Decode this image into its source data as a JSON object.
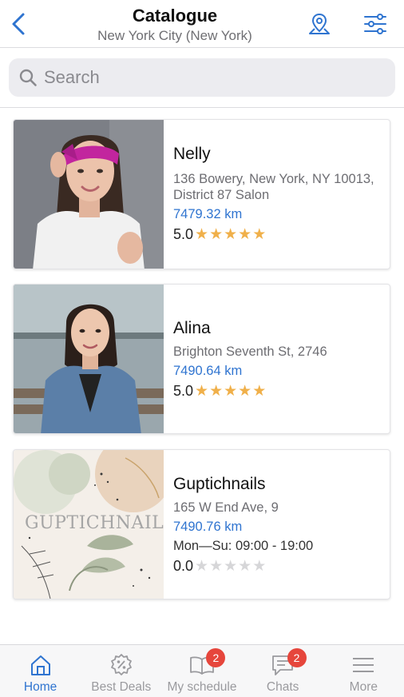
{
  "header": {
    "title": "Catalogue",
    "subtitle": "New York City (New York)",
    "back_icon": "chevron-left-icon",
    "map_icon": "map-pin-icon",
    "filter_icon": "sliders-icon"
  },
  "search": {
    "placeholder": "Search",
    "value": ""
  },
  "colors": {
    "accent": "#2f74d0",
    "star": "#f0b04a",
    "badge": "#e6463c"
  },
  "listings": [
    {
      "name": "Nelly",
      "address": "136 Bowery, New York, NY 10013, District 87 Salon",
      "distance": "7479.32 km",
      "rating": "5.0",
      "stars": 5
    },
    {
      "name": "Alina",
      "address": "Brighton Seventh St,  2746",
      "distance": "7490.64 km",
      "rating": "5.0",
      "stars": 5
    },
    {
      "name": "Guptichnails",
      "address": "165 W End Ave,  9",
      "distance": "7490.76 km",
      "hours": "Mon—Su: 09:00 - 19:00",
      "rating": "0.0",
      "stars": 0,
      "logo_text": "GUPTICHNAILS"
    }
  ],
  "tabs": [
    {
      "label": "Home",
      "icon": "home-icon",
      "active": true
    },
    {
      "label": "Best Deals",
      "icon": "discount-badge-icon"
    },
    {
      "label": "My schedule",
      "icon": "book-icon",
      "badge": "2"
    },
    {
      "label": "Chats",
      "icon": "chat-icon",
      "badge": "2"
    },
    {
      "label": "More",
      "icon": "menu-icon"
    }
  ]
}
